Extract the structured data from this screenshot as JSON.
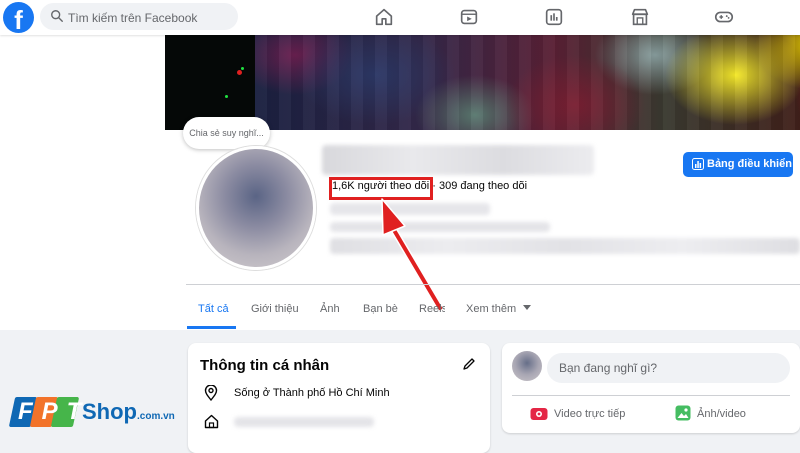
{
  "header": {
    "logo_letter": "f",
    "search": {
      "placeholder": "Tìm kiếm trên Facebook"
    },
    "nav_icons": [
      "home-icon",
      "watch-icon",
      "dashboard-icon",
      "marketplace-icon",
      "gaming-icon"
    ]
  },
  "profile": {
    "thought_bubble": "Chia sẻ suy nghĩ...",
    "followers_text": "1,6K người theo dõi",
    "separator": "·",
    "following_text": "309 đang theo dõi",
    "dashboard_button": "Bảng điều khiển"
  },
  "tabs": [
    {
      "label": "Tất cả",
      "active": true
    },
    {
      "label": "Giới thiệu"
    },
    {
      "label": "Ảnh"
    },
    {
      "label": "Bạn bè"
    },
    {
      "label": "Reels"
    },
    {
      "label": "Xem thêm"
    }
  ],
  "intro": {
    "title": "Thông tin cá nhân",
    "lives_in": "Sống ở Thành phố Hồ Chí Minh"
  },
  "composer": {
    "placeholder": "Bạn đang nghĩ gì?",
    "live_video": "Video trực tiếp",
    "photo_video": "Ảnh/video"
  },
  "watermark": {
    "brand": "FPT",
    "shop": "Shop",
    "domain": ".com.vn"
  },
  "colors": {
    "facebook_blue": "#1877f2",
    "highlight_red": "#e02020",
    "background": "#f0f2f5"
  }
}
